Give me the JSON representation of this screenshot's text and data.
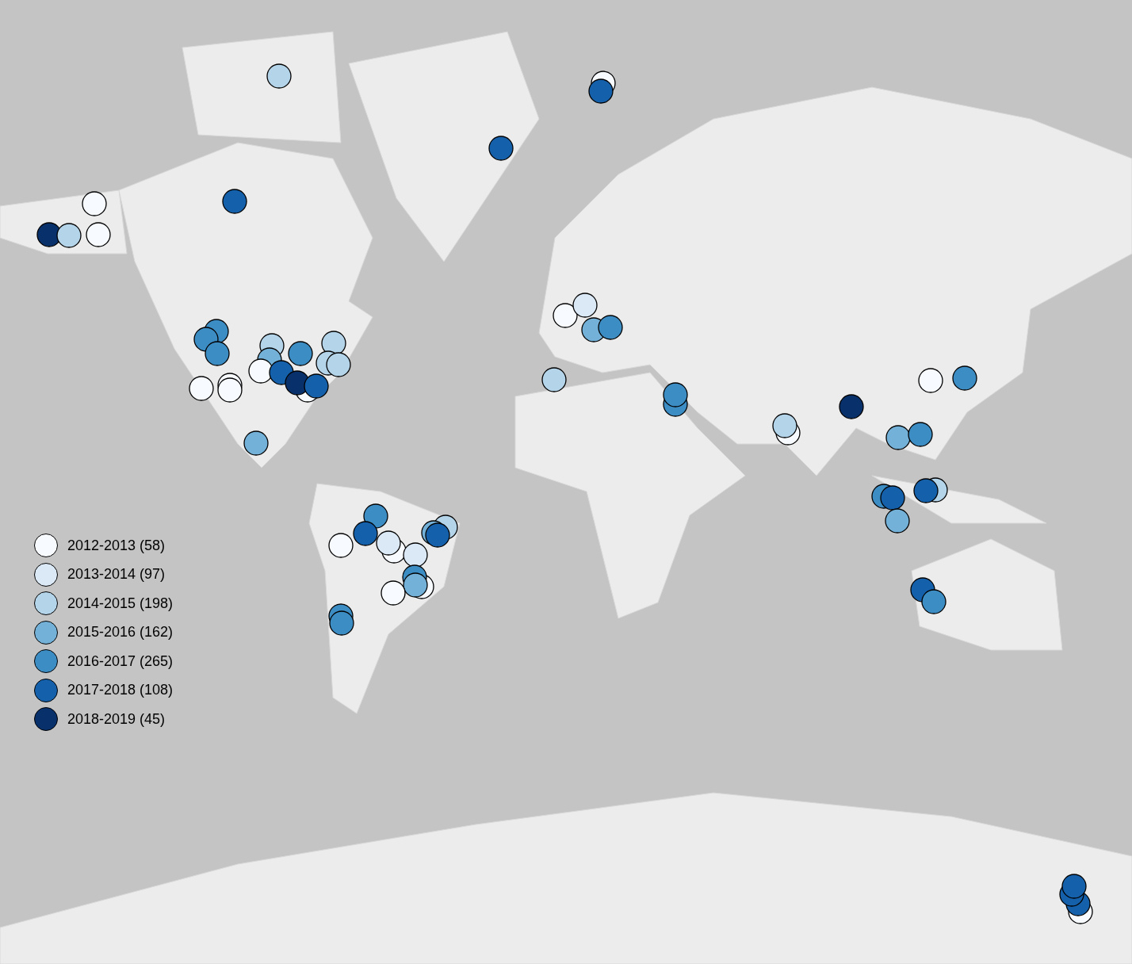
{
  "legend": [
    {
      "label": "2012-2013 (58)",
      "color": "#f7fbff"
    },
    {
      "label": "2013-2014 (97)",
      "color": "#dbe9f6"
    },
    {
      "label": "2014-2015 (198)",
      "color": "#b4d4ea"
    },
    {
      "label": "2015-2016 (162)",
      "color": "#73b1d8"
    },
    {
      "label": "2016-2017 (265)",
      "color": "#3d8dc5"
    },
    {
      "label": "2017-2018 (108)",
      "color": "#1560aa"
    },
    {
      "label": "2018-2019 (45)",
      "color": "#08306b"
    }
  ],
  "pins": [
    {
      "color": "#b4d4ea"
    },
    {
      "color": "#f7fbff"
    },
    {
      "color": "#1560aa"
    },
    {
      "color": "#1560aa"
    },
    {
      "color": "#f7fbff"
    },
    {
      "color": "#08306b"
    },
    {
      "color": "#b4d4ea"
    },
    {
      "color": "#f7fbff"
    },
    {
      "color": "#1560aa"
    },
    {
      "color": "#3d8dc5"
    },
    {
      "color": "#3d8dc5"
    },
    {
      "color": "#3d8dc5"
    },
    {
      "color": "#f7fbff"
    },
    {
      "color": "#f7fbff"
    },
    {
      "color": "#f7fbff"
    },
    {
      "color": "#f7fbff"
    },
    {
      "color": "#b4d4ea"
    },
    {
      "color": "#b4d4ea"
    },
    {
      "color": "#3d8dc5"
    },
    {
      "color": "#73b1d8"
    },
    {
      "color": "#f7fbff"
    },
    {
      "color": "#b4d4ea"
    },
    {
      "color": "#b4d4ea"
    },
    {
      "color": "#1560aa"
    },
    {
      "color": "#08306b"
    },
    {
      "color": "#1560aa"
    },
    {
      "color": "#73b1d8"
    },
    {
      "color": "#f7fbff"
    },
    {
      "color": "#dbe9f6"
    },
    {
      "color": "#73b1d8"
    },
    {
      "color": "#3d8dc5"
    },
    {
      "color": "#b4d4ea"
    },
    {
      "color": "#3d8dc5"
    },
    {
      "color": "#3d8dc5"
    },
    {
      "color": "#f7fbff"
    },
    {
      "color": "#b4d4ea"
    },
    {
      "color": "#08306b"
    },
    {
      "color": "#f7fbff"
    },
    {
      "color": "#3d8dc5"
    },
    {
      "color": "#73b1d8"
    },
    {
      "color": "#3d8dc5"
    },
    {
      "color": "#3d8dc5"
    },
    {
      "color": "#1560aa"
    },
    {
      "color": "#73b1d8"
    },
    {
      "color": "#b4d4ea"
    },
    {
      "color": "#1560aa"
    },
    {
      "color": "#1560aa"
    },
    {
      "color": "#3d8dc5"
    },
    {
      "color": "#f7fbff"
    },
    {
      "color": "#1560aa"
    },
    {
      "color": "#1560aa"
    },
    {
      "color": "#1560aa"
    },
    {
      "color": "#3d8dc5"
    },
    {
      "color": "#1560aa"
    },
    {
      "color": "#f7fbff"
    },
    {
      "color": "#f7fbff"
    },
    {
      "color": "#dbe9f6"
    },
    {
      "color": "#dbe9f6"
    },
    {
      "color": "#b4d4ea"
    },
    {
      "color": "#73b1d8"
    },
    {
      "color": "#1560aa"
    },
    {
      "color": "#f7fbff"
    },
    {
      "color": "#3d8dc5"
    },
    {
      "color": "#73b1d8"
    },
    {
      "color": "#f7fbff"
    },
    {
      "color": "#3d8dc5"
    },
    {
      "color": "#3d8dc5"
    }
  ]
}
